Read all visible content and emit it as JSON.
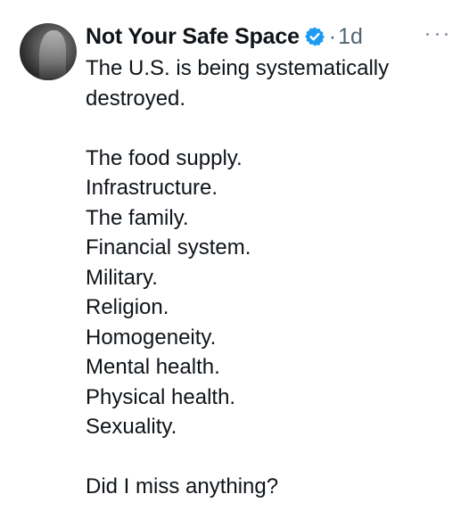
{
  "tweet": {
    "display_name": "Not Your Safe Space",
    "separator": "·",
    "time": "1d",
    "intro": [
      "The U.S. is being systematically",
      "destroyed."
    ],
    "list": [
      "The food supply.",
      "Infrastructure.",
      "The family.",
      "Financial system.",
      "Military.",
      "Religion.",
      "Homogeneity.",
      "Mental health.",
      "Physical health.",
      "Sexuality."
    ],
    "closing": "Did I miss anything?"
  },
  "icons": {
    "verified": "verified-badge-icon",
    "more": "more-horizontal-icon"
  },
  "colors": {
    "verified_blue": "#1d9bf0",
    "text": "#0f1419",
    "secondary": "#536471"
  }
}
